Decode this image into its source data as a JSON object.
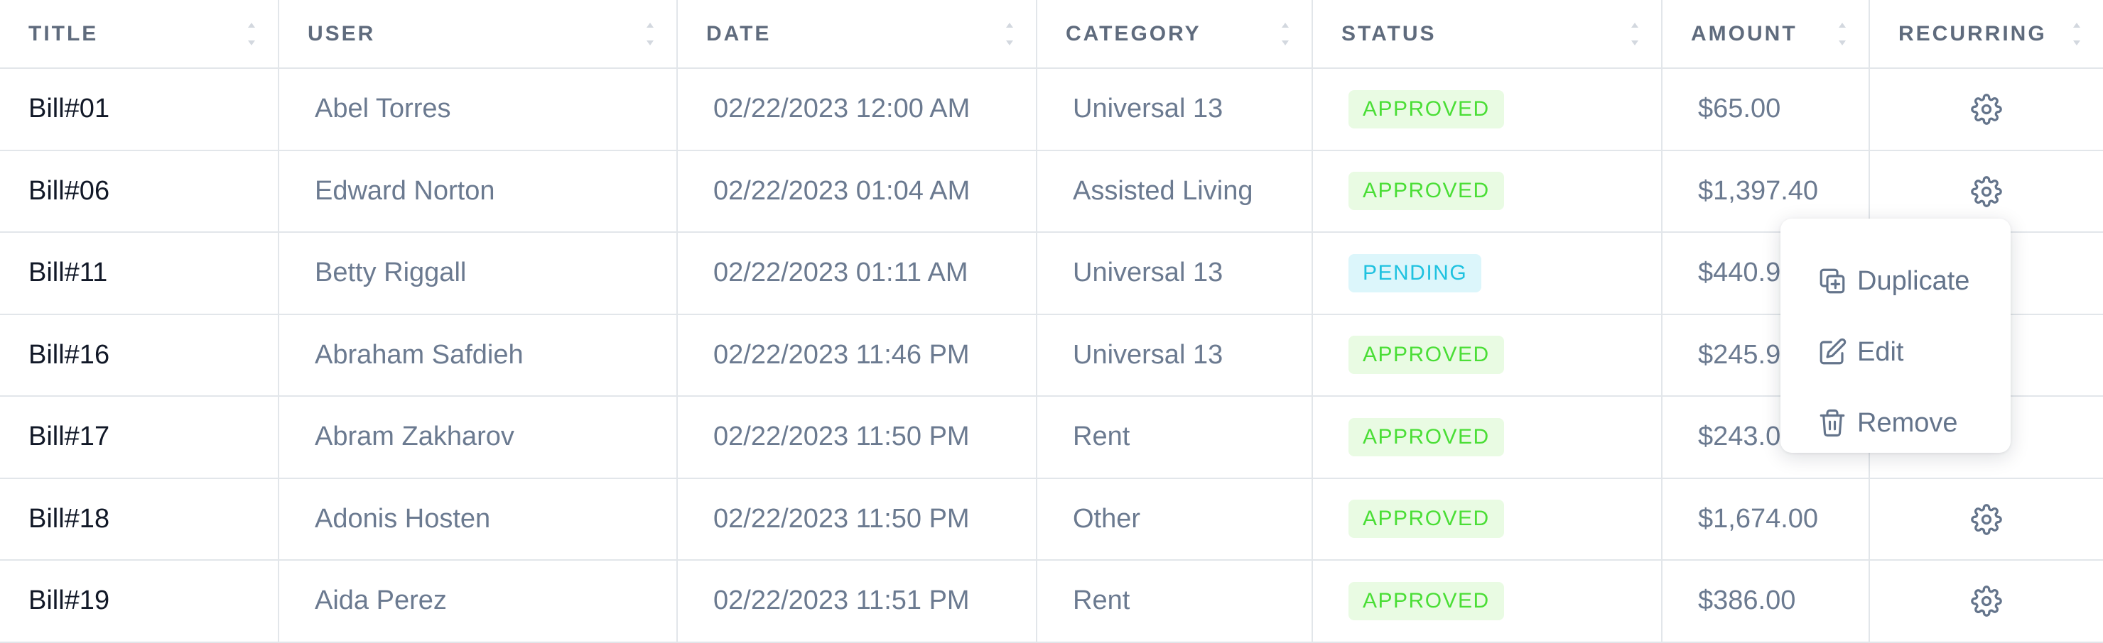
{
  "columns": [
    "TITLE",
    "USER",
    "DATE",
    "CATEGORY",
    "STATUS",
    "AMOUNT",
    "RECURRING"
  ],
  "rows": [
    {
      "title": "Bill#01",
      "user": "Abel Torres",
      "date": "02/22/2023 12:00 AM",
      "category": "Universal 13",
      "status": "APPROVED",
      "amount": "$65.00"
    },
    {
      "title": "Bill#06",
      "user": "Edward Norton",
      "date": "02/22/2023 01:04 AM",
      "category": "Assisted Living",
      "status": "APPROVED",
      "amount": "$1,397.40"
    },
    {
      "title": "Bill#11",
      "user": "Betty Riggall",
      "date": "02/22/2023 01:11 AM",
      "category": "Universal 13",
      "status": "PENDING",
      "amount": "$440.9"
    },
    {
      "title": "Bill#16",
      "user": "Abraham Safdieh",
      "date": "02/22/2023 11:46 PM",
      "category": "Universal 13",
      "status": "APPROVED",
      "amount": "$245.9"
    },
    {
      "title": "Bill#17",
      "user": "Abram Zakharov",
      "date": "02/22/2023 11:50 PM",
      "category": "Rent",
      "status": "APPROVED",
      "amount": "$243.0"
    },
    {
      "title": "Bill#18",
      "user": "Adonis Hosten",
      "date": "02/22/2023 11:50 PM",
      "category": "Other",
      "status": "APPROVED",
      "amount": "$1,674.00"
    },
    {
      "title": "Bill#19",
      "user": "Aida Perez",
      "date": "02/22/2023 11:51 PM",
      "category": "Rent",
      "status": "APPROVED",
      "amount": "$386.00"
    }
  ],
  "recurring_icon": "gear-icon",
  "context_menu": {
    "open_row": 1,
    "items": [
      {
        "label": "Duplicate",
        "icon": "duplicate-icon"
      },
      {
        "label": "Edit",
        "icon": "edit-icon"
      },
      {
        "label": "Remove",
        "icon": "trash-icon"
      }
    ]
  },
  "colors": {
    "approved_text": "#4ade36",
    "approved_bg": "#e9fbe3",
    "pending_text": "#1fc2e0",
    "pending_bg": "#dcf6fb",
    "border": "#e2e6ea"
  }
}
